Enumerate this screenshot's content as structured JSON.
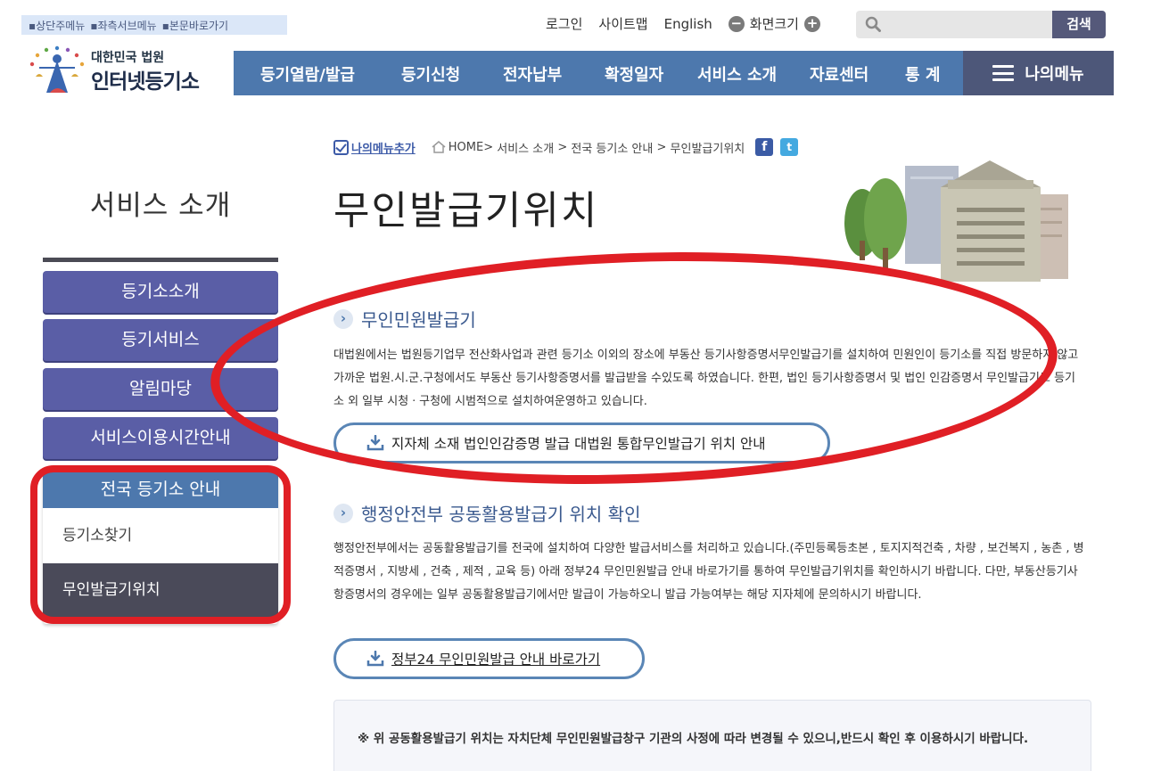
{
  "skip_links": [
    "▪상단주메뉴",
    "▪좌측서브메뉴",
    "▪본문바로가기"
  ],
  "utility": {
    "login": "로그인",
    "sitemap": "사이트맵",
    "english": "English",
    "zoom_label": "화면크기",
    "zoom_minus": "−",
    "zoom_plus": "+"
  },
  "search": {
    "placeholder": "",
    "button": "검색"
  },
  "logo": {
    "small": "대한민국 법원",
    "big": "인터넷등기소"
  },
  "gnb": [
    "등기열람/발급",
    "등기신청",
    "전자납부",
    "확정일자",
    "서비스 소개",
    "자료센터",
    "통 계"
  ],
  "my_menu": "나의메뉴",
  "breadcrumb": {
    "add_menu": "나의메뉴추가",
    "home": "HOME",
    "path1": "서비스 소개",
    "path2": "전국 등기소 안내",
    "path3": "무인발급기위치"
  },
  "sidebar": {
    "title": "서비스 소개",
    "items": [
      "등기소소개",
      "등기서비스",
      "알림마당",
      "서비스이용시간안내"
    ],
    "group_head": "전국 등기소 안내",
    "sub_items": [
      "등기소찾기",
      "무인발급기위치"
    ]
  },
  "page_title": "무인발급기위치",
  "section1": {
    "heading": "무인민원발급기",
    "body": "대법원에서는 법원등기업무 전산화사업과 관련 등기소 이외의 장소에 부동산 등기사항증명서무인발급기를 설치하여 민원인이 등기소를 직접 방문하지 않고 가까운 법원.시.군.구청에서도 부동산 등기사항증명서를 발급받을 수있도록 하였습니다. 한편, 법인 등기사항증명서 및 법인 인감증명서 무인발급기도 등기소 외 일부 시청ㆍ구청에 시범적으로 설치하여운영하고 있습니다.",
    "button": "지자체 소재 법인인감증명 발급 대법원 통합무인발급기 위치 안내"
  },
  "section2": {
    "heading": "행정안전부 공동활용발급기 위치 확인",
    "body": "행정안전부에서는 공동활용발급기를 전국에 설치하여 다양한 발급서비스를 처리하고 있습니다.(주민등록등초본 , 토지지적건축 , 차량 , 보건복지 , 농촌 , 병적증명서 , 지방세 , 건축 , 제적 , 교육 등) 아래 정부24 무인민원발급 안내 바로가기를 통하여 무인발급기위치를 확인하시기 바랍니다. 다만, 부동산등기사항증명서의 경우에는 일부 공동활용발급기에서만 발급이 가능하오니 발급 가능여부는 해당 지자체에 문의하시기 바랍니다.",
    "button": "정부24 무인민원발급 안내 바로가기"
  },
  "notice": "※ 위 공동활용발급기 위치는 자치단체 무인민원발급창구 기관의 사정에 따라 변경될 수 있으니,반드시 확인 후 이용하시기 바랍니다.",
  "colors": {
    "gnb": "#4d78ad",
    "my_menu": "#4d5779",
    "sidebar_button": "#5a5ea6",
    "active_sub": "#4a4a59",
    "annotation_red": "#e01f25"
  }
}
